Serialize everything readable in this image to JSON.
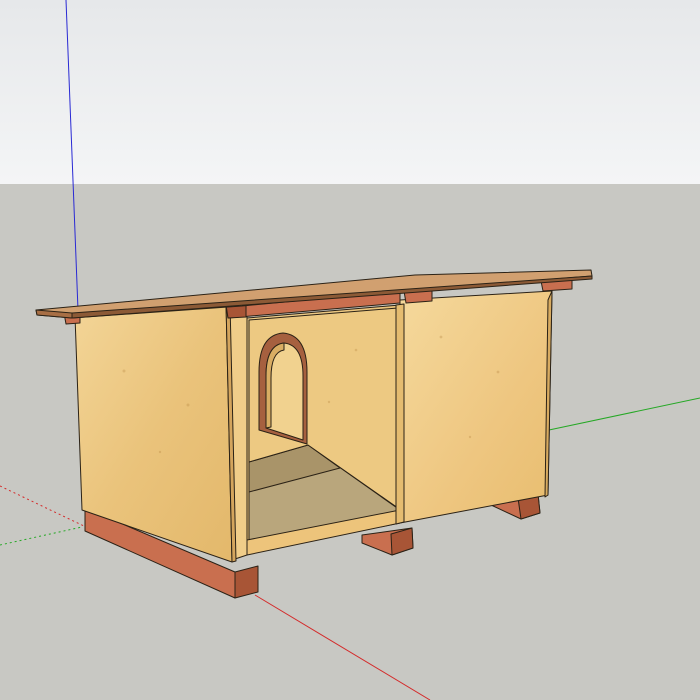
{
  "app": {
    "view": "3d-viewport",
    "object": "dog-house-model"
  },
  "colors": {
    "sky_top": "#e6e8ea",
    "sky_bottom": "#f4f5f6",
    "ground": "#c8c8c3",
    "plywood_light": "#f1d08f",
    "plywood_mid": "#e8c077",
    "plywood_shadow": "#d8ab60",
    "wood_base": "#c96f4f",
    "wood_base_dark": "#9e4f34",
    "roof": "#d1a070",
    "axis_red": "#d42a2a",
    "axis_green": "#25a825",
    "axis_blue": "#2a2ad4",
    "edge": "#2b2216"
  }
}
